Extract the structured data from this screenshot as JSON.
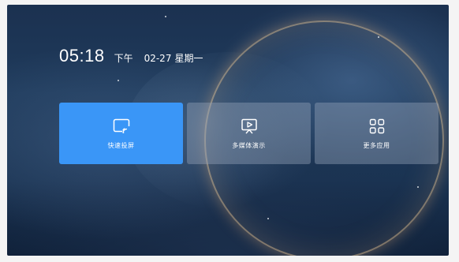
{
  "status": {
    "time": "05:18",
    "period": "下午",
    "date": "02-27",
    "weekday": "星期一"
  },
  "tiles": [
    {
      "label": "快速投屏",
      "icon": "cast-screen-icon",
      "selected": true
    },
    {
      "label": "多媒体演示",
      "icon": "media-play-icon",
      "selected": false
    },
    {
      "label": "更多应用",
      "icon": "app-grid-icon",
      "selected": false
    }
  ],
  "colors": {
    "accent": "#3a96f7",
    "tile_background": "#8a9bb3",
    "text": "#ffffff"
  }
}
